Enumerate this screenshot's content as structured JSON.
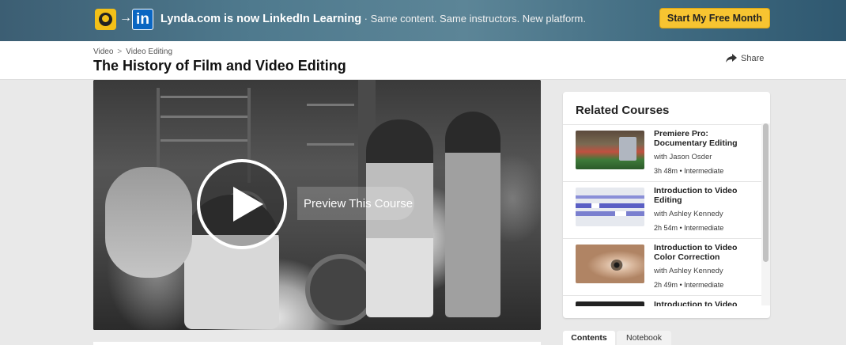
{
  "banner": {
    "headline": "Lynda.com is now LinkedIn Learning",
    "subline": " · Same content. Same instructors. New platform.",
    "cta_label": "Start My Free Month",
    "linkedin_glyph": "in",
    "arrow_glyph": "→"
  },
  "header": {
    "breadcrumb": [
      "Video",
      "Video Editing"
    ],
    "breadcrumb_sep": ">",
    "title": "The History of Film and Video Editing",
    "share_label": "Share"
  },
  "video": {
    "preview_label": "Preview This Course"
  },
  "related": {
    "title": "Related Courses",
    "items": [
      {
        "name": "Premiere Pro: Documentary Editing",
        "author": "with Jason Osder",
        "meta": "3h 48m  •  Intermediate",
        "thumb": "market-stall"
      },
      {
        "name": "Introduction to Video Editing",
        "author": "with Ashley Kennedy",
        "meta": "2h 54m  •  Intermediate",
        "thumb": "timeline"
      },
      {
        "name": "Introduction to Video Color Correction",
        "author": "with Ashley Kennedy",
        "meta": "2h 49m  •  Intermediate",
        "thumb": "eye-closeup"
      },
      {
        "name": "Introduction to Video",
        "author": "",
        "meta": "",
        "thumb": "dark-clip"
      }
    ]
  },
  "tabs": {
    "contents": "Contents",
    "notebook": "Notebook"
  }
}
